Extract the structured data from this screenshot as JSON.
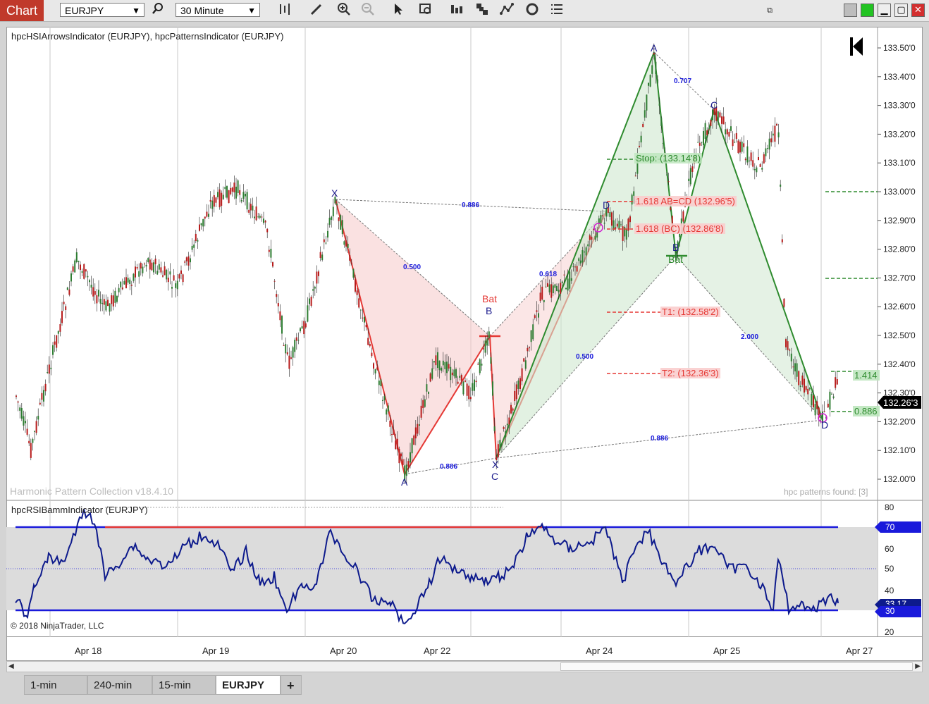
{
  "toolbar": {
    "tab_label": "Chart",
    "instrument": "EURJPY",
    "interval": "30 Minute"
  },
  "panel": {
    "indicators_title": "hpcHSIArrowsIndicator (EURJPY), hpcPatternsIndicator (EURJPY)",
    "watermark": "Harmonic Pattern Collection v18.4.10",
    "patterns_found": "hpc patterns found: [3]",
    "last_price": "132.26'3",
    "price_ticks": [
      "133.50'0",
      "133.40'0",
      "133.30'0",
      "133.20'0",
      "133.10'0",
      "133.00'0",
      "132.90'0",
      "132.80'0",
      "132.70'0",
      "132.60'0",
      "132.50'0",
      "132.40'0",
      "132.30'0",
      "132.20'0",
      "132.10'0",
      "132.00'0"
    ],
    "labels": {
      "stop": "Stop: (133.14'8)",
      "abcd": "1.618 AB=CD (132.96'5)",
      "bc": "1.618 (BC) (132.86'8)",
      "t1": "T1: (132.58'2)",
      "t2": "T2: (132.36'3)",
      "right_1414": "1.414",
      "right_0886": "0.886"
    },
    "pattern1": {
      "X": "X",
      "A": "A",
      "B": "B",
      "C": "C",
      "D": "D",
      "name": "Bat",
      "r_xb": "0.500",
      "r_xd": "0.886",
      "r_ac": "0.886",
      "r_bd": "0.618"
    },
    "pattern2": {
      "X": "X",
      "A": "A",
      "B": "B",
      "C": "C",
      "D": "D",
      "name": "Bat",
      "r_xb": "0.500",
      "r_xd": "0.886",
      "r_ac": "0.707",
      "r_bd": "2.000"
    }
  },
  "rsi": {
    "title": "hpcRSIBammIndicator (EURJPY)",
    "ticks": [
      "80",
      "60",
      "50",
      "40",
      "20"
    ],
    "level_high": "70",
    "level_low": "30",
    "current": "33.17",
    "copyright": "© 2018 NinjaTrader, LLC"
  },
  "xaxis": {
    "dates": [
      "Apr 18",
      "Apr 19",
      "Apr 20",
      "Apr 22",
      "Apr 24",
      "Apr 25",
      "Apr 27"
    ]
  },
  "tabs": [
    {
      "label": "1-min"
    },
    {
      "label": "240-min"
    },
    {
      "label": "15-min"
    },
    {
      "label": "EURJPY"
    }
  ],
  "add_tab": "+",
  "colors": {
    "bull": "#2e7d32",
    "bear": "#b71c1c",
    "pattern_red": "#e53935",
    "pattern_green": "#2e8b2e",
    "rsi_line": "#0d1a8c",
    "rsi_band": "#1a1adb"
  },
  "icons": [
    "search-icon",
    "bars-icon",
    "pencil-icon",
    "zoom-in-icon",
    "zoom-out-icon",
    "cursor-icon",
    "data-box-icon",
    "layout-icon",
    "strategy-icon",
    "indicator-icon",
    "reload-icon",
    "properties-icon"
  ]
}
